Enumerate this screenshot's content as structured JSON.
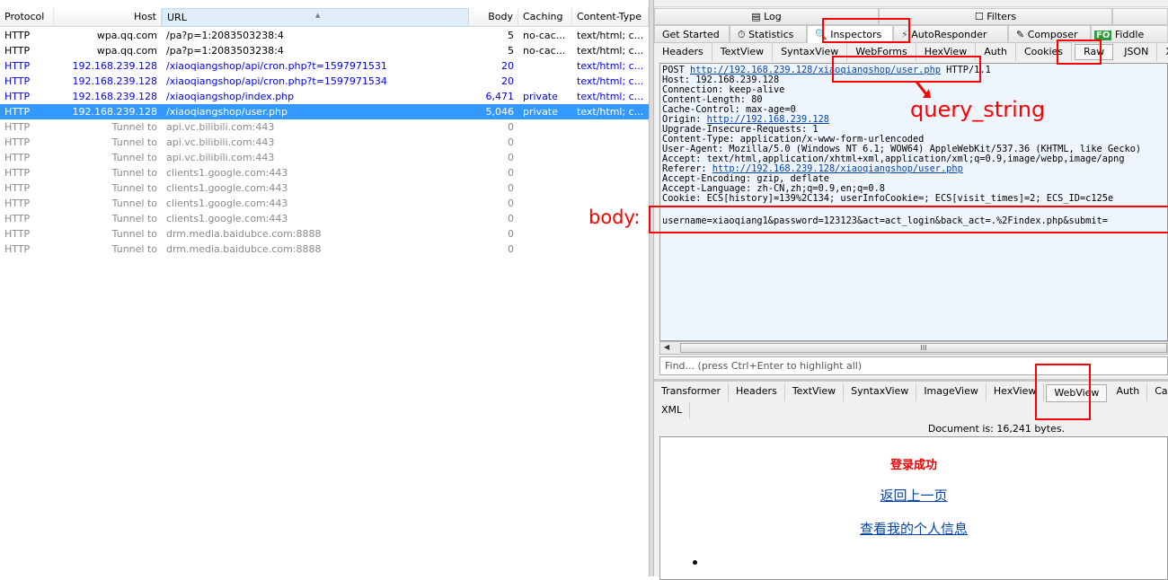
{
  "sessions": {
    "columns": [
      "Protocol",
      "Host",
      "URL",
      "Body",
      "Caching",
      "Content-Type"
    ],
    "rows": [
      {
        "protocol": "HTTP",
        "host": "wpa.qq.com",
        "url": "/pa?p=1:2083503238:4",
        "body": "5",
        "caching": "no-cac...",
        "ctype": "text/html; c...",
        "style": "normal"
      },
      {
        "protocol": "HTTP",
        "host": "wpa.qq.com",
        "url": "/pa?p=1:2083503238:4",
        "body": "5",
        "caching": "no-cac...",
        "ctype": "text/html; c...",
        "style": "normal"
      },
      {
        "protocol": "HTTP",
        "host": "192.168.239.128",
        "url": "/xiaoqiangshop/api/cron.php?t=1597971531",
        "body": "20",
        "caching": "",
        "ctype": "text/html; c...",
        "style": "blue"
      },
      {
        "protocol": "HTTP",
        "host": "192.168.239.128",
        "url": "/xiaoqiangshop/api/cron.php?t=1597971534",
        "body": "20",
        "caching": "",
        "ctype": "text/html; c...",
        "style": "blue"
      },
      {
        "protocol": "HTTP",
        "host": "192.168.239.128",
        "url": "/xiaoqiangshop/index.php",
        "body": "6,471",
        "caching": "private",
        "ctype": "text/html; c...",
        "style": "blue"
      },
      {
        "protocol": "HTTP",
        "host": "192.168.239.128",
        "url": "/xiaoqiangshop/user.php",
        "body": "5,046",
        "caching": "private",
        "ctype": "text/html; c...",
        "style": "sel"
      },
      {
        "protocol": "HTTP",
        "host": "Tunnel to",
        "url": "api.vc.bilibili.com:443",
        "body": "0",
        "caching": "",
        "ctype": "",
        "style": "gray"
      },
      {
        "protocol": "HTTP",
        "host": "Tunnel to",
        "url": "api.vc.bilibili.com:443",
        "body": "0",
        "caching": "",
        "ctype": "",
        "style": "gray"
      },
      {
        "protocol": "HTTP",
        "host": "Tunnel to",
        "url": "api.vc.bilibili.com:443",
        "body": "0",
        "caching": "",
        "ctype": "",
        "style": "gray"
      },
      {
        "protocol": "HTTP",
        "host": "Tunnel to",
        "url": "clients1.google.com:443",
        "body": "0",
        "caching": "",
        "ctype": "",
        "style": "gray"
      },
      {
        "protocol": "HTTP",
        "host": "Tunnel to",
        "url": "clients1.google.com:443",
        "body": "0",
        "caching": "",
        "ctype": "",
        "style": "gray"
      },
      {
        "protocol": "HTTP",
        "host": "Tunnel to",
        "url": "clients1.google.com:443",
        "body": "0",
        "caching": "",
        "ctype": "",
        "style": "gray"
      },
      {
        "protocol": "HTTP",
        "host": "Tunnel to",
        "url": "clients1.google.com:443",
        "body": "0",
        "caching": "",
        "ctype": "",
        "style": "gray"
      },
      {
        "protocol": "HTTP",
        "host": "Tunnel to",
        "url": "drm.media.baidubce.com:8888",
        "body": "0",
        "caching": "",
        "ctype": "",
        "style": "gray"
      },
      {
        "protocol": "HTTP",
        "host": "Tunnel to",
        "url": "drm.media.baidubce.com:8888",
        "body": "0",
        "caching": "",
        "ctype": "",
        "style": "gray"
      }
    ]
  },
  "tabs_top": {
    "log": "Log",
    "filters": "Filters"
  },
  "tabs_main": {
    "get_started": "Get Started",
    "statistics": "Statistics",
    "inspectors": "Inspectors",
    "autoresponder": "AutoResponder",
    "composer": "Composer",
    "fiddler": "Fiddle",
    "fo_badge": "FO"
  },
  "request_tabs": [
    "Headers",
    "TextView",
    "SyntaxView",
    "WebForms",
    "HexView",
    "Auth",
    "Cookies",
    "Raw",
    "JSON",
    "XI"
  ],
  "raw": {
    "method": "POST ",
    "url": "http://192.168.239.128/xiaoqiangshop/user.php",
    "version": " HTTP/1.1",
    "lines1": [
      "Host: 192.168.239.128",
      "Connection: keep-alive",
      "Content-Length: 80",
      "Cache-Control: max-age=0"
    ],
    "origin_label": "Origin: ",
    "origin_url": "http://192.168.239.128",
    "lines2": [
      "Upgrade-Insecure-Requests: 1",
      "Content-Type: application/x-www-form-urlencoded",
      "User-Agent: Mozilla/5.0 (Windows NT 6.1; WOW64) AppleWebKit/537.36 (KHTML, like Gecko)",
      "Accept: text/html,application/xhtml+xml,application/xml;q=0.9,image/webp,image/apng"
    ],
    "referer_label": "Referer: ",
    "referer_url": "http://192.168.239.128/xiaoqiangshop/user.php",
    "lines3": [
      "Accept-Encoding: gzip, deflate",
      "Accept-Language: zh-CN,zh;q=0.9,en;q=0.8",
      "Cookie: ECS[history]=139%2C134; userInfoCookie=; ECS[visit_times]=2; ECS_ID=c125e"
    ],
    "body": "username=xiaoqiang1&password=123123&act=act_login&back_act=.%2Findex.php&submit="
  },
  "find_placeholder": "Find... (press Ctrl+Enter to highlight all)",
  "response_tabs": [
    "Transformer",
    "Headers",
    "TextView",
    "SyntaxView",
    "ImageView",
    "HexView",
    "WebView",
    "Auth",
    "Cach"
  ],
  "response_tabs2": [
    "XML"
  ],
  "doc_size": "Document is: 16,241 bytes.",
  "webview": {
    "title": "登录成功",
    "link1": "返回上一页",
    "link2": "查看我的个人信息"
  },
  "annotations": {
    "query_string": "query_string",
    "body": "body:"
  },
  "colors": {
    "selection": "#3399ff",
    "annotation": "#ff0000",
    "link": "#0645ad"
  }
}
